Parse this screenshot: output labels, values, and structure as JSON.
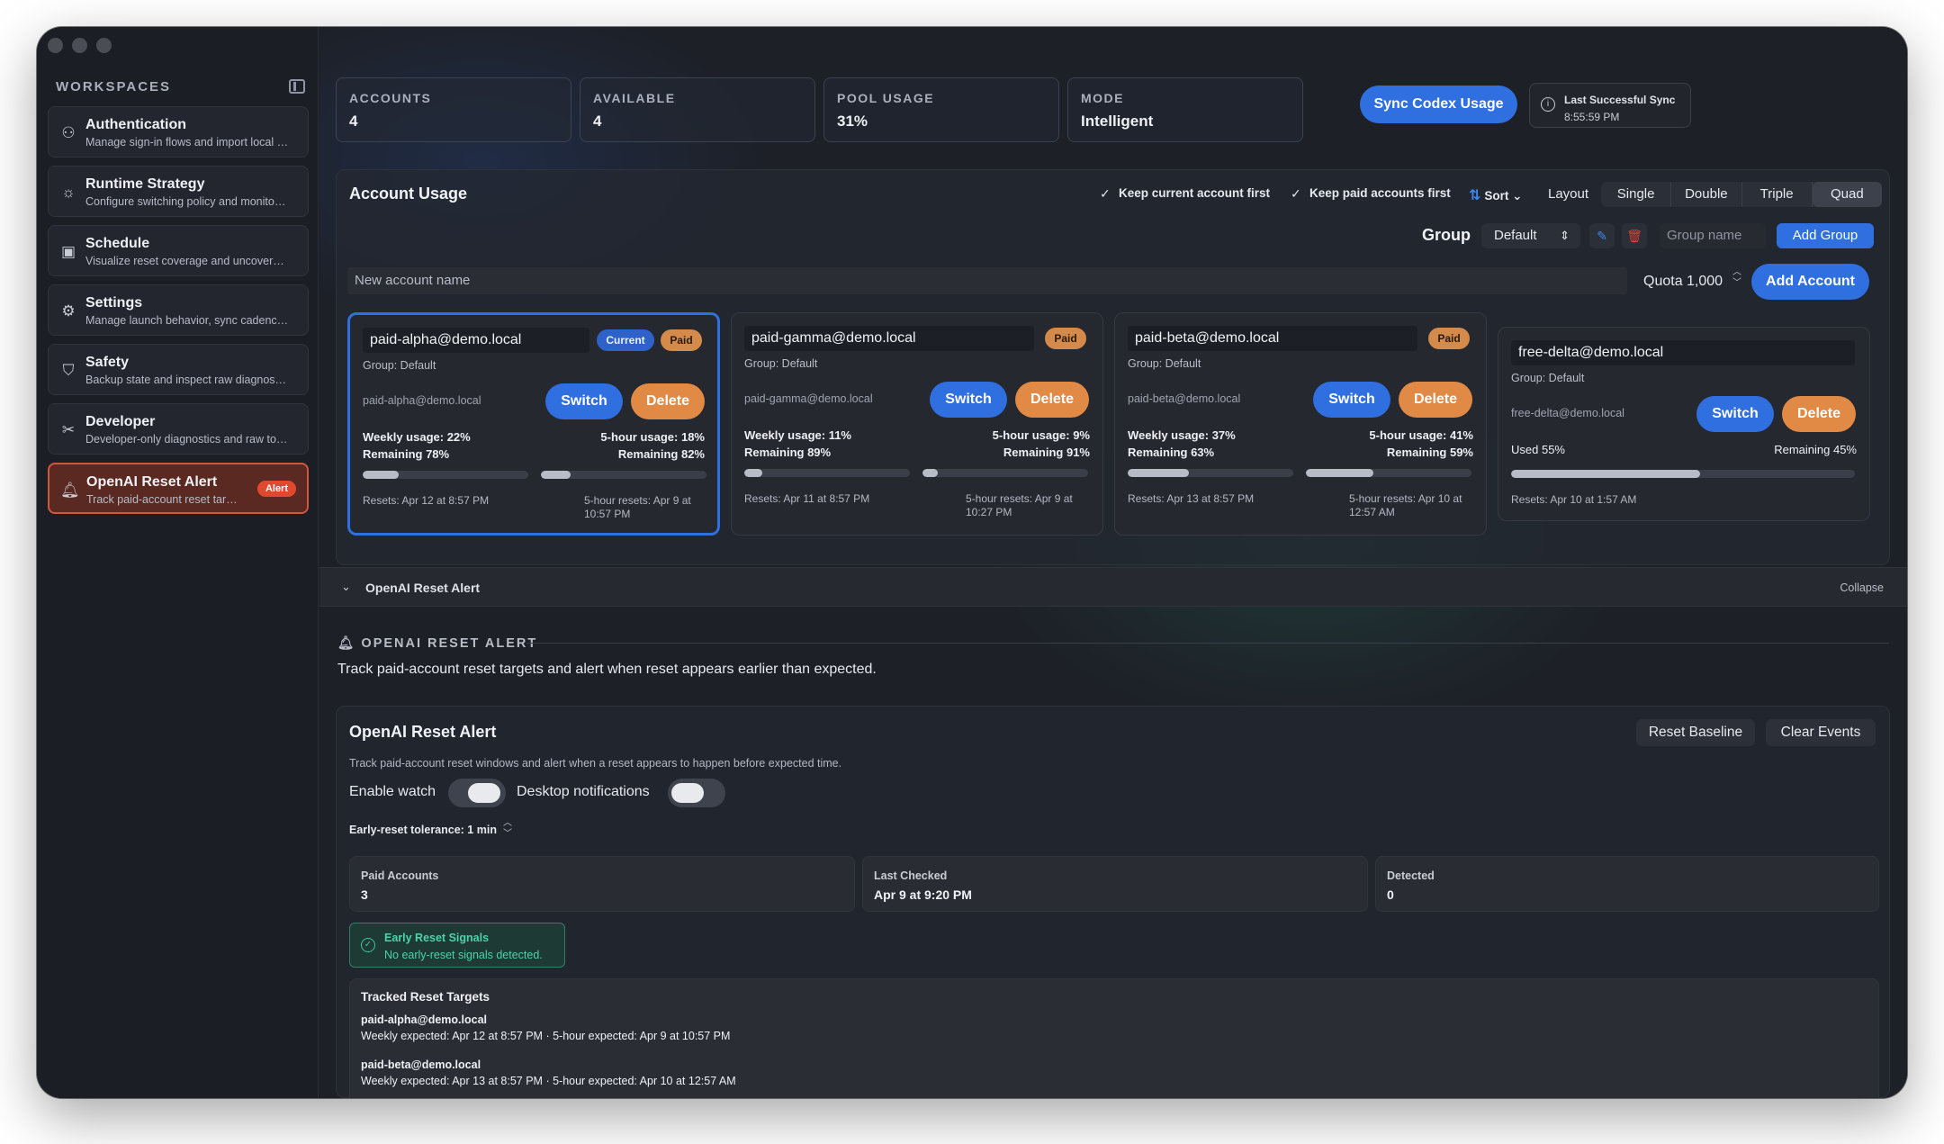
{
  "sidebar": {
    "title": "WORKSPACES",
    "items": [
      {
        "label": "Authentication",
        "desc": "Manage sign-in flows and import local credentials",
        "icon": "user-key-icon"
      },
      {
        "label": "Runtime Strategy",
        "desc": "Configure switching policy and monitoring",
        "icon": "sun-gear-icon"
      },
      {
        "label": "Schedule",
        "desc": "Visualize reset coverage and uncovered windows",
        "icon": "calendar-clock-icon"
      },
      {
        "label": "Settings",
        "desc": "Manage launch behavior, sync cadence and more",
        "icon": "gear-icon"
      },
      {
        "label": "Safety",
        "desc": "Backup state and inspect raw diagnostics",
        "icon": "shield-icon"
      },
      {
        "label": "Developer",
        "desc": "Developer-only diagnostics and raw tools",
        "icon": "tools-icon"
      },
      {
        "label": "OpenAI Reset Alert",
        "desc": "Track paid-account reset targets",
        "icon": "bell-icon",
        "badge": "Alert"
      }
    ]
  },
  "stats": [
    {
      "key": "ACCOUNTS",
      "value": "4"
    },
    {
      "key": "AVAILABLE",
      "value": "4"
    },
    {
      "key": "POOL USAGE",
      "value": "31%"
    },
    {
      "key": "MODE",
      "value": "Intelligent"
    }
  ],
  "sync": {
    "button": "Sync Codex Usage",
    "last_label": "Last Successful Sync",
    "last_value": "8:55:59 PM"
  },
  "usage": {
    "title": "Account Usage",
    "keep_current": "Keep current account first",
    "keep_paid": "Keep paid accounts first",
    "sort": "Sort",
    "layout_label": "Layout",
    "layouts": [
      "Single",
      "Double",
      "Triple",
      "Quad"
    ],
    "group_label": "Group",
    "group_value": "Default",
    "group_placeholder": "Group name",
    "add_group": "Add Group",
    "new_account_placeholder": "New account name",
    "quota": "Quota 1,000",
    "add_account": "Add Account"
  },
  "cards": [
    {
      "email": "paid-alpha@demo.local",
      "current": "Current",
      "paid": "Paid",
      "group": "Group: Default",
      "sub": "paid-alpha@demo.local",
      "switch": "Switch",
      "delete": "Delete",
      "weekly": "Weekly usage: 22%",
      "weekly_rem": "Remaining 78%",
      "hour": "5-hour usage: 18%",
      "hour_rem": "Remaining 82%",
      "weekly_frac": 0.22,
      "hour_frac": 0.18,
      "resets": "Resets: Apr 12 at 8:57 PM",
      "hour_resets": "5-hour resets: Apr 9 at 10:57 PM"
    },
    {
      "email": "paid-gamma@demo.local",
      "paid": "Paid",
      "group": "Group: Default",
      "sub": "paid-gamma@demo.local",
      "switch": "Switch",
      "delete": "Delete",
      "weekly": "Weekly usage: 11%",
      "weekly_rem": "Remaining 89%",
      "hour": "5-hour usage: 9%",
      "hour_rem": "Remaining 91%",
      "weekly_frac": 0.11,
      "hour_frac": 0.09,
      "resets": "Resets: Apr 11 at 8:57 PM",
      "hour_resets": "5-hour resets: Apr 9 at 10:27 PM"
    },
    {
      "email": "paid-beta@demo.local",
      "paid": "Paid",
      "group": "Group: Default",
      "sub": "paid-beta@demo.local",
      "switch": "Switch",
      "delete": "Delete",
      "weekly": "Weekly usage: 37%",
      "weekly_rem": "Remaining 63%",
      "hour": "5-hour usage: 41%",
      "hour_rem": "Remaining 59%",
      "weekly_frac": 0.37,
      "hour_frac": 0.41,
      "resets": "Resets: Apr 13 at 8:57 PM",
      "hour_resets": "5-hour resets: Apr 10 at 12:57 AM"
    },
    {
      "email": "free-delta@demo.local",
      "group": "Group: Default",
      "sub": "free-delta@demo.local",
      "switch": "Switch",
      "delete": "Delete",
      "used": "Used 55%",
      "remaining": "Remaining 45%",
      "frac": 0.55,
      "resets": "Resets: Apr 10 at 1:57 AM"
    }
  ],
  "section": {
    "title": "OpenAI Reset Alert",
    "collapse": "Collapse"
  },
  "alert": {
    "heading": "OPENAI RESET ALERT",
    "desc": "Track paid-account reset targets and alert when reset appears earlier than expected.",
    "panel_title": "OpenAI Reset Alert",
    "reset_baseline": "Reset Baseline",
    "clear_events": "Clear Events",
    "panel_desc": "Track paid-account reset windows and alert when a reset appears to happen before expected time.",
    "enable_watch": "Enable watch",
    "desktop_notifications": "Desktop notifications",
    "tolerance": "Early-reset tolerance: 1 min",
    "paid_accounts_label": "Paid Accounts",
    "paid_accounts_value": "3",
    "last_checked_label": "Last Checked",
    "last_checked_value": "Apr 9 at 9:20 PM",
    "detected_label": "Detected",
    "detected_value": "0",
    "signals_title": "Early Reset Signals",
    "signals_desc": "No early-reset signals detected.",
    "tracked_title": "Tracked Reset Targets",
    "tracked": [
      {
        "account": "paid-alpha@demo.local",
        "detail": "Weekly expected: Apr 12 at 8:57 PM · 5-hour expected: Apr 9 at 10:57 PM"
      },
      {
        "account": "paid-beta@demo.local",
        "detail": "Weekly expected: Apr 13 at 8:57 PM · 5-hour expected: Apr 10 at 12:57 AM"
      }
    ]
  }
}
